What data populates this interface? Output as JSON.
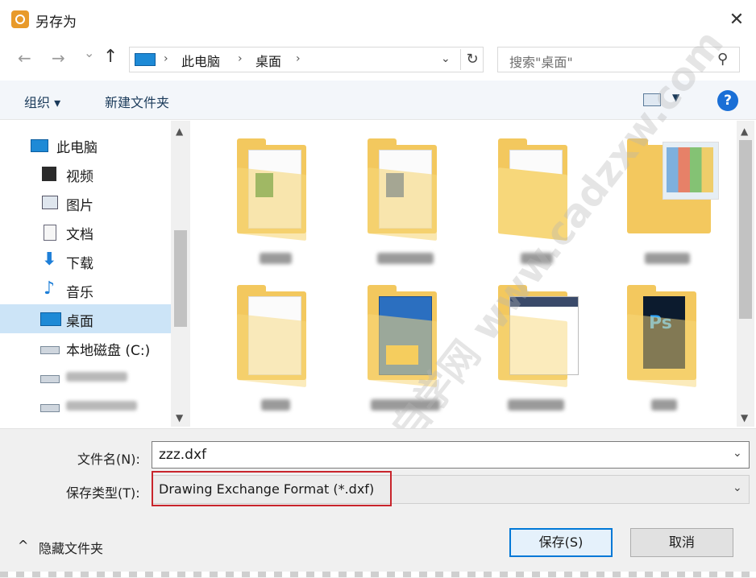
{
  "window": {
    "title": "另存为",
    "close_label": "✕"
  },
  "address": {
    "back_label": "←",
    "forward_label": "→",
    "recent_label": "⌄",
    "up_label": "↑",
    "crumbs": [
      "此电脑",
      "桌面"
    ],
    "separator": "›",
    "refresh_label": "↻",
    "dropdown_label": "⌄"
  },
  "search": {
    "placeholder": "搜索\"桌面\""
  },
  "toolbar": {
    "organize_label": "组织 ▾",
    "new_folder_label": "新建文件夹",
    "help_label": "?",
    "view_dd": "▼"
  },
  "sidebar": {
    "items": [
      {
        "label": "此电脑",
        "icon": "monitor-icon"
      },
      {
        "label": "视频",
        "icon": "video-icon"
      },
      {
        "label": "图片",
        "icon": "picture-icon"
      },
      {
        "label": "文档",
        "icon": "document-icon"
      },
      {
        "label": "下载",
        "icon": "download-icon"
      },
      {
        "label": "音乐",
        "icon": "music-icon"
      },
      {
        "label": "桌面",
        "icon": "desktop-icon",
        "selected": true
      },
      {
        "label": "本地磁盘 (C:)",
        "icon": "drive-icon"
      }
    ],
    "scroll_up": "▲",
    "scroll_down": "▼"
  },
  "content": {
    "scroll_up": "▲",
    "scroll_down": "▼"
  },
  "form": {
    "filename_label": "文件名(N):",
    "filename_value": "zzz.dxf",
    "filetype_label": "保存类型(T):",
    "filetype_value": "Drawing Exchange Format (*.dxf)",
    "chevron": "⌄"
  },
  "footer": {
    "hide_folders_label": "隐藏文件夹",
    "hide_folders_icon": "^",
    "save_label": "保存(S)",
    "cancel_label": "取消"
  },
  "watermark": {
    "text": "CAD自学网 www.cadzxw.com"
  },
  "colors": {
    "accent": "#0078d7",
    "highlight_box": "#c8252c",
    "selected_row": "#cce4f7"
  }
}
